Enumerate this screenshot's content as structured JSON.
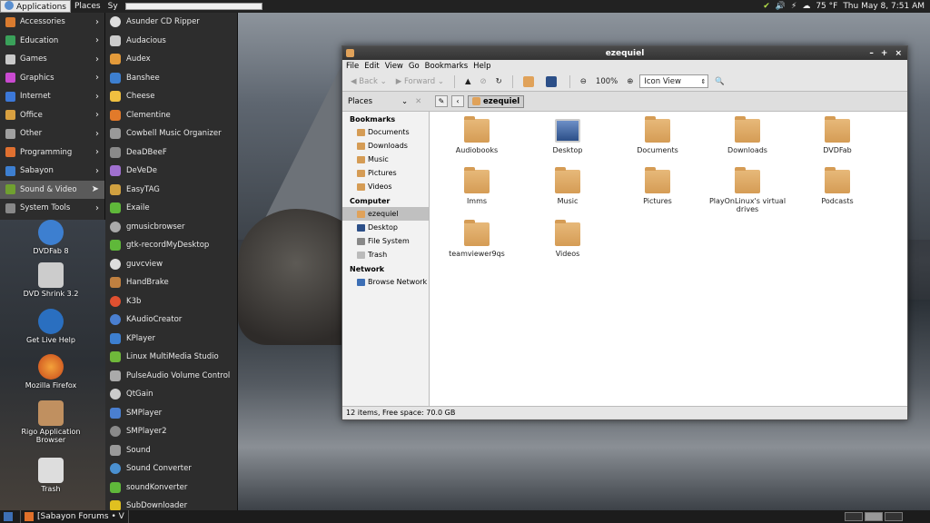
{
  "top_panel": {
    "menus": [
      "Applications",
      "Places",
      "Sy"
    ],
    "weather": "75 °F",
    "clock": "Thu May  8,  7:51 AM"
  },
  "app_menu": {
    "categories": [
      {
        "label": "Accessories",
        "icon": "accessories-icon",
        "color": "#d97b2f"
      },
      {
        "label": "Education",
        "icon": "education-icon",
        "color": "#3aa15a"
      },
      {
        "label": "Games",
        "icon": "games-icon",
        "color": "#c9c9c9"
      },
      {
        "label": "Graphics",
        "icon": "graphics-icon",
        "color": "#c94ad0"
      },
      {
        "label": "Internet",
        "icon": "internet-icon",
        "color": "#3c78d8"
      },
      {
        "label": "Office",
        "icon": "office-icon",
        "color": "#d8a040"
      },
      {
        "label": "Other",
        "icon": "other-icon",
        "color": "#a0a0a0"
      },
      {
        "label": "Programming",
        "icon": "programming-icon",
        "color": "#e07030"
      },
      {
        "label": "Sabayon",
        "icon": "sabayon-icon",
        "color": "#3d7fd0"
      },
      {
        "label": "Sound & Video",
        "icon": "sound-video-icon",
        "color": "#70a030"
      },
      {
        "label": "System Tools",
        "icon": "system-tools-icon",
        "color": "#888888"
      }
    ],
    "selected": "Sound & Video"
  },
  "sub_menu": {
    "items": [
      {
        "label": "Asunder CD Ripper",
        "icon": "cd-icon",
        "color": "#dddddd"
      },
      {
        "label": "Audacious",
        "icon": "audacious-icon",
        "color": "#cccccc"
      },
      {
        "label": "Audex",
        "icon": "audex-icon",
        "color": "#e39a3a"
      },
      {
        "label": "Banshee",
        "icon": "banshee-icon",
        "color": "#3d7fd0"
      },
      {
        "label": "Cheese",
        "icon": "cheese-icon",
        "color": "#f0c040"
      },
      {
        "label": "Clementine",
        "icon": "clementine-icon",
        "color": "#e27a2a"
      },
      {
        "label": "Cowbell Music Organizer",
        "icon": "cowbell-icon",
        "color": "#999999"
      },
      {
        "label": "DeaDBeeF",
        "icon": "deadbeef-icon",
        "color": "#8a8a8a"
      },
      {
        "label": "DeVeDe",
        "icon": "devede-icon",
        "color": "#a070d0"
      },
      {
        "label": "EasyTAG",
        "icon": "easytag-icon",
        "color": "#d0a040"
      },
      {
        "label": "Exaile",
        "icon": "exaile-icon",
        "color": "#5fb83a"
      },
      {
        "label": "gmusicbrowser",
        "icon": "gmusicbrowser-icon",
        "color": "#aaaaaa"
      },
      {
        "label": "gtk-recordMyDesktop",
        "icon": "record-icon",
        "color": "#5fb83a"
      },
      {
        "label": "guvcview",
        "icon": "guvcview-icon",
        "color": "#dddddd"
      },
      {
        "label": "HandBrake",
        "icon": "handbrake-icon",
        "color": "#c08040"
      },
      {
        "label": "K3b",
        "icon": "k3b-icon",
        "color": "#e05030"
      },
      {
        "label": "KAudioCreator",
        "icon": "kaudiocreator-icon",
        "color": "#4a7fd0"
      },
      {
        "label": "KPlayer",
        "icon": "kplayer-icon",
        "color": "#3d7fd0"
      },
      {
        "label": "Linux MultiMedia Studio",
        "icon": "lmms-icon",
        "color": "#6fb83a"
      },
      {
        "label": "PulseAudio Volume Control",
        "icon": "pulseaudio-icon",
        "color": "#aaaaaa"
      },
      {
        "label": "QtGain",
        "icon": "qtgain-icon",
        "color": "#cccccc"
      },
      {
        "label": "SMPlayer",
        "icon": "smplayer-icon",
        "color": "#4a7fd0"
      },
      {
        "label": "SMPlayer2",
        "icon": "smplayer2-icon",
        "color": "#8a8a8a"
      },
      {
        "label": "Sound",
        "icon": "sound-icon",
        "color": "#999999"
      },
      {
        "label": "Sound Converter",
        "icon": "soundconverter-icon",
        "color": "#4a90d0"
      },
      {
        "label": "soundKonverter",
        "icon": "soundkonverter-icon",
        "color": "#5fb83a"
      },
      {
        "label": "SubDownloader",
        "icon": "subdownloader-icon",
        "color": "#e0c020"
      }
    ]
  },
  "desktop_icons": [
    {
      "label": "DVDFab 8",
      "icon": "dvdfab-icon",
      "color": "#3d7fd0"
    },
    {
      "label": "DVD Shrink 3.2",
      "icon": "dvdshrink-icon",
      "color": "#cccccc"
    },
    {
      "label": "Get Live Help",
      "icon": "live-help-icon",
      "color": "#2a6fc0"
    },
    {
      "label": "Mozilla Firefox",
      "icon": "firefox-icon",
      "color": "#e0702a"
    },
    {
      "label": "Rigo Application Browser",
      "icon": "rigo-icon",
      "color": "#c09060"
    },
    {
      "label": "Trash",
      "icon": "trash-icon",
      "color": "#dddddd"
    }
  ],
  "window": {
    "title": "ezequiel",
    "menus": [
      "File",
      "Edit",
      "View",
      "Go",
      "Bookmarks",
      "Help"
    ],
    "toolbar": {
      "back": "Back",
      "forward": "Forward",
      "zoom": "100%",
      "view_mode": "Icon View"
    },
    "places_label": "Places",
    "location": "ezequiel",
    "sidebar": {
      "bookmarks_header": "Bookmarks",
      "bookmarks": [
        "Documents",
        "Downloads",
        "Music",
        "Pictures",
        "Videos"
      ],
      "computer_header": "Computer",
      "computer": [
        "ezequiel",
        "Desktop",
        "File System",
        "Trash"
      ],
      "network_header": "Network",
      "network": [
        "Browse Network"
      ]
    },
    "files": [
      "Audiobooks",
      "Desktop",
      "Documents",
      "Downloads",
      "DVDFab",
      "Imms",
      "Music",
      "Pictures",
      "PlayOnLinux's virtual drives",
      "Podcasts",
      "teamviewer9qs",
      "Videos"
    ],
    "status": "12 items, Free space: 70.0 GB"
  },
  "taskbar": {
    "task": "[Sabayon Forums • V"
  }
}
